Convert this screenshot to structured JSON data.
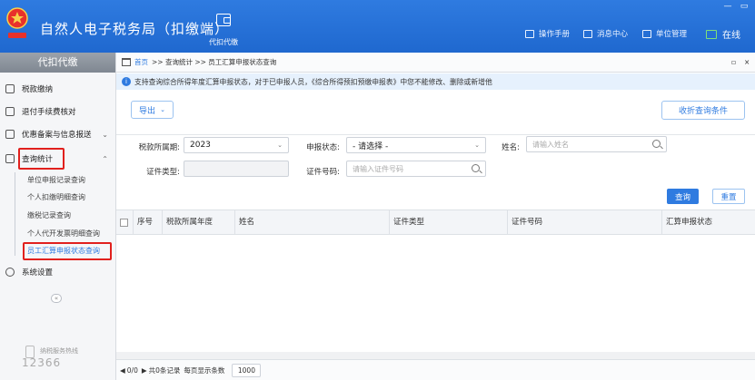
{
  "app": {
    "title": "自然人电子税务局（扣缴端）",
    "logo_text": "中国税务"
  },
  "header": {
    "nav_tab_label": "代扣代缴",
    "links": [
      {
        "label": "操作手册",
        "icon": "manual-icon"
      },
      {
        "label": "消息中心",
        "icon": "message-icon"
      },
      {
        "label": "单位管理",
        "icon": "company-icon"
      }
    ],
    "online_label": "在线",
    "window_controls": {
      "minimize": "—",
      "maximize": "▭"
    }
  },
  "sidebar": {
    "title": "代扣代缴",
    "items": [
      {
        "label": "税款缴纳",
        "icon": "tax-payment-icon"
      },
      {
        "label": "退付手续费核对",
        "icon": "refund-check-icon"
      },
      {
        "label": "优惠备案与信息报送",
        "icon": "preferential-filing-icon",
        "chevron": "⌄"
      },
      {
        "label": "查询统计",
        "icon": "query-stats-icon",
        "chevron": "⌃"
      },
      {
        "label": "系统设置",
        "icon": "settings-icon"
      }
    ],
    "sub_items": [
      {
        "label": "单位申报记录查询"
      },
      {
        "label": "个人扣缴明细查询"
      },
      {
        "label": "缴税记录查询"
      },
      {
        "label": "个人代开发票明细查询"
      },
      {
        "label": "员工汇算申报状态查询"
      }
    ],
    "collapse_symbol": "«",
    "hotline_label": "纳税服务热线",
    "hotline_number": "12366"
  },
  "breadcrumb": {
    "home": "首页",
    "path": ">> 查询统计 >> 员工汇算申报状态查询",
    "restore_symbol": "▫",
    "close_symbol": "×"
  },
  "notice": {
    "icon_char": "i",
    "text": "支持查询综合所得年度汇算申报状态，对于已申报人员，《综合所得预扣预缴申报表》中您不能修改、删除或新增他"
  },
  "toolbar": {
    "export_label": "导出",
    "export_caret": "⌄",
    "collapse_label": "收折查询条件"
  },
  "filters": {
    "tax_period_label": "税款所属期:",
    "tax_period_value": "2023",
    "status_label": "申报状态:",
    "status_value": "- 请选择 -",
    "name_label": "姓名:",
    "name_placeholder": "请输入姓名",
    "cert_type_label": "证件类型:",
    "cert_no_label": "证件号码:",
    "cert_no_placeholder": "请输入证件号码",
    "dropdown_caret": "⌄"
  },
  "actions": {
    "query_label": "查询",
    "reset_label": "重置"
  },
  "table": {
    "columns": [
      "序号",
      "税款所属年度",
      "姓名",
      "证件类型",
      "证件号码",
      "汇算申报状态"
    ],
    "rows": []
  },
  "pagination": {
    "prev": "◀",
    "page": "0/0",
    "next": "▶",
    "total": "共0条记录",
    "per_page_label": "每页显示条数",
    "per_page_value": "1000"
  },
  "colors": {
    "header_blue": "#2f7be0",
    "highlight_red": "#e1201d",
    "online_green": "#7fe07a"
  }
}
